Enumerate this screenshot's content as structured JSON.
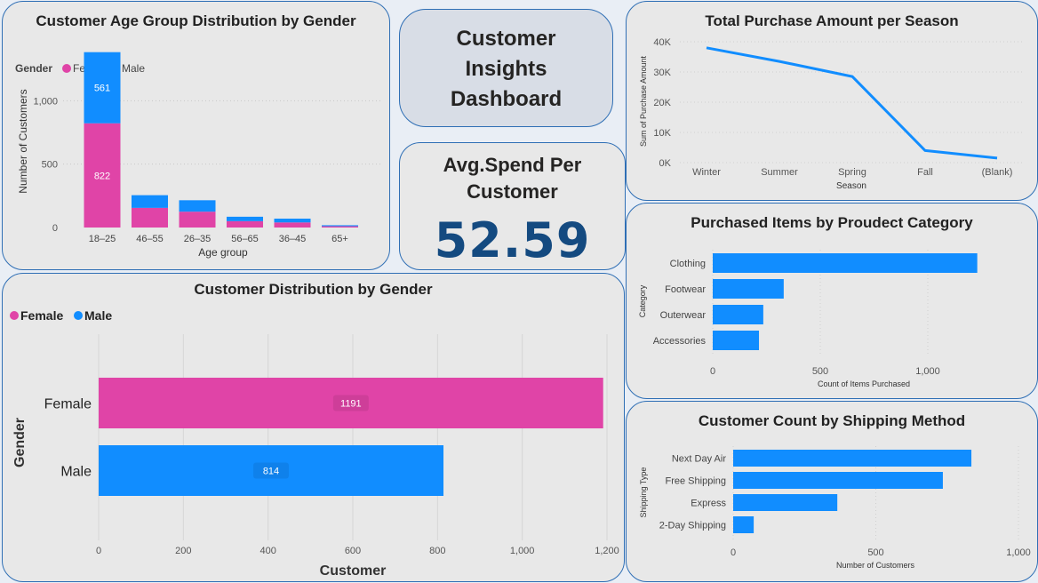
{
  "dashboard_title": "Customer Insights Dashboard",
  "kpi": {
    "label": "Avg.Spend Per Customer",
    "value": "52.59"
  },
  "colors": {
    "female": "#e044a7",
    "male": "#118dff"
  },
  "chart_data": [
    {
      "id": "age",
      "type": "bar",
      "stacked": true,
      "title": "Customer Age Group Distribution by Gender",
      "legend_title": "Gender",
      "legend_position": "top-left",
      "xlabel": "Age group",
      "ylabel": "Number of Customers",
      "categories": [
        "18–25",
        "46–55",
        "26–35",
        "56–65",
        "36–45",
        "65+"
      ],
      "series": [
        {
          "name": "Female",
          "values": [
            822,
            155,
            125,
            50,
            40,
            10
          ]
        },
        {
          "name": "Male",
          "values": [
            561,
            100,
            90,
            35,
            30,
            8
          ]
        }
      ],
      "data_labels": {
        "Female": [
          "822",
          "",
          "",
          "",
          "",
          ""
        ],
        "Male": [
          "561",
          "",
          "",
          "",
          "",
          ""
        ]
      },
      "yticks": [
        0,
        500,
        1000
      ],
      "ytick_labels": [
        "0",
        "500",
        "1,000"
      ],
      "ylim": [
        0,
        1500
      ],
      "grid": true
    },
    {
      "id": "gender",
      "type": "bar",
      "orientation": "horizontal",
      "title": "Customer Distribution by Gender",
      "legend_position": "top-left",
      "xlabel": "Customer",
      "ylabel": "Gender",
      "categories": [
        "Female",
        "Male"
      ],
      "values": [
        1191,
        814
      ],
      "data_labels": [
        "1191",
        "814"
      ],
      "series_names": [
        "Female",
        "Male"
      ],
      "xticks": [
        0,
        200,
        400,
        600,
        800,
        1000,
        1200
      ],
      "xtick_labels": [
        "0",
        "200",
        "400",
        "600",
        "800",
        "1,000",
        "1,200"
      ],
      "xlim": [
        0,
        1200
      ],
      "grid": true
    },
    {
      "id": "season",
      "type": "line",
      "title": "Total Purchase Amount per Season",
      "xlabel": "Season",
      "ylabel": "Sum of Purchase Amount",
      "categories": [
        "Winter",
        "Summer",
        "Spring",
        "Fall",
        "(Blank)"
      ],
      "values": [
        38000,
        33500,
        28500,
        4000,
        1500
      ],
      "yticks": [
        0,
        10000,
        20000,
        30000,
        40000
      ],
      "ytick_labels": [
        "0K",
        "10K",
        "20K",
        "30K",
        "40K"
      ],
      "ylim": [
        0,
        40000
      ],
      "grid": true
    },
    {
      "id": "category",
      "type": "bar",
      "orientation": "horizontal",
      "title": "Purchased Items by Proudect Category",
      "xlabel": "Count of Items Purchased",
      "ylabel": "Category",
      "categories": [
        "Clothing",
        "Footwear",
        "Outerwear",
        "Accessories"
      ],
      "values": [
        1230,
        330,
        235,
        215
      ],
      "xticks": [
        0,
        500,
        1000
      ],
      "xtick_labels": [
        "0",
        "500",
        "1,000"
      ],
      "xlim": [
        0,
        1300
      ],
      "grid": true
    },
    {
      "id": "shipping",
      "type": "bar",
      "orientation": "horizontal",
      "title": "Customer Count by Shipping Method",
      "xlabel": "Number of Customers",
      "ylabel": "Shipping Type",
      "categories": [
        "Next Day Air",
        "Free Shipping",
        "Express",
        "2-Day Shipping"
      ],
      "values": [
        835,
        735,
        365,
        72
      ],
      "xticks": [
        0,
        500,
        1000
      ],
      "xtick_labels": [
        "0",
        "500",
        "1,000"
      ],
      "xlim": [
        0,
        1000
      ],
      "grid": true
    }
  ]
}
